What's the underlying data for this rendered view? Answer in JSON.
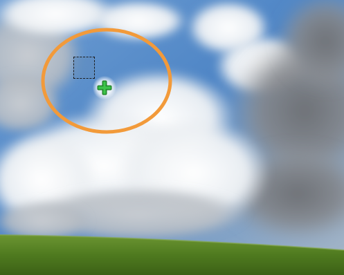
{
  "canvas": {
    "content": "sky-and-grass-photo",
    "colors": {
      "sky_blue": "#4f86c6",
      "cloud_white": "#e9ecef",
      "cloud_gray": "#7c7f84",
      "grass_green": "#4f7a1f",
      "highlight_orange": "#f29a3a",
      "cursor_green": "#2ea83a"
    }
  },
  "tool": {
    "cursor_icon": "add-selection-plus-icon",
    "selection_marker": "dashed-square-selection"
  }
}
